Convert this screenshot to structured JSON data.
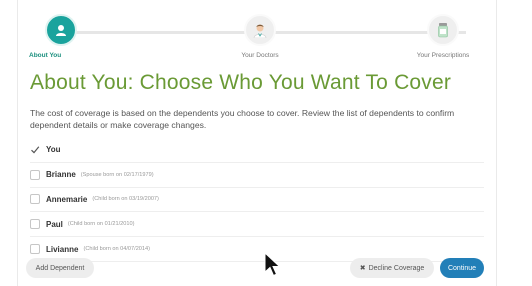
{
  "stepper": {
    "steps": [
      {
        "label": "About You",
        "state": "active",
        "icon": "person-icon"
      },
      {
        "label": "Your Doctors",
        "state": "pending",
        "icon": "doctor-icon"
      },
      {
        "label": "Your Prescriptions",
        "state": "pending",
        "icon": "prescription-bottle-icon"
      }
    ]
  },
  "page": {
    "title": "About You: Choose Who You Want To Cover",
    "intro": "The cost of coverage is based on the dependents you choose to cover. Review the list of dependents to confirm dependent details or make coverage changes."
  },
  "dependents": [
    {
      "name": "You",
      "detail": "",
      "checked": true
    },
    {
      "name": "Brianne",
      "detail": "(Spouse born on 02/17/1979)",
      "checked": false
    },
    {
      "name": "Annemarie",
      "detail": "(Child born on 03/19/2007)",
      "checked": false
    },
    {
      "name": "Paul",
      "detail": "(Child born on 01/21/2010)",
      "checked": false
    },
    {
      "name": "Livianne",
      "detail": "(Child born on 04/07/2014)",
      "checked": false
    }
  ],
  "buttons": {
    "add_dependent": "Add Dependent",
    "decline_coverage": "Decline Coverage",
    "decline_icon": "✖",
    "continue": "Continue"
  },
  "colors": {
    "accent_teal": "#1aa39d",
    "title_green": "#6a9a35",
    "continue_blue": "#227fb8"
  }
}
